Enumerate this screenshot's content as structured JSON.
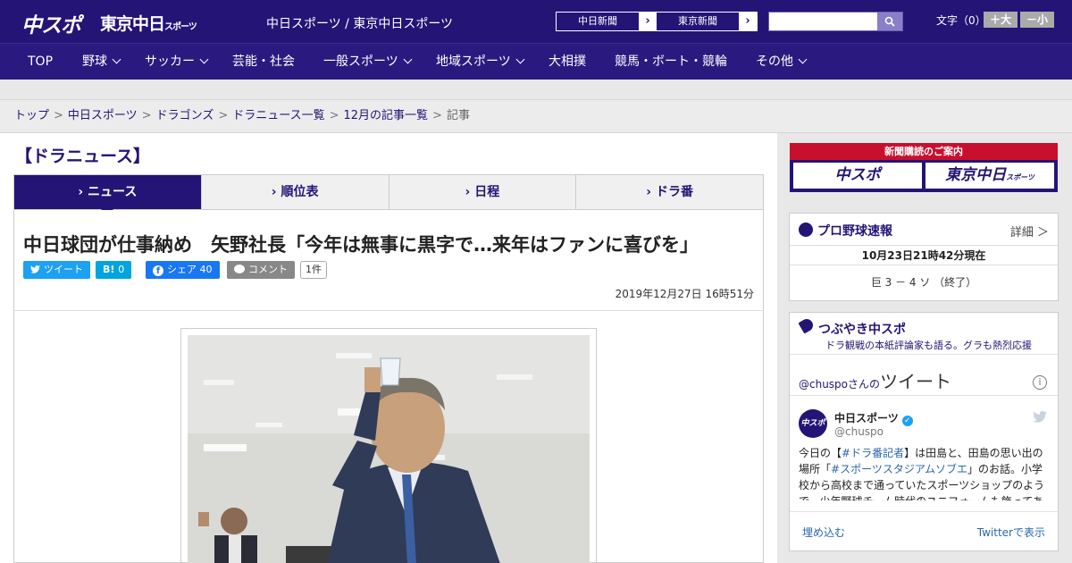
{
  "header": {
    "logo_chuspo": "中スポ",
    "logo_tokyo": "東京中日",
    "logo_tokyo_suffix": "スポーツ",
    "site_link": "中日スポーツ / 東京中日スポーツ",
    "newspaper_links": [
      "中日新聞",
      "東京新聞"
    ],
    "search_placeholder": "",
    "font_size_label": "文字（0）",
    "font_bigger": "＋大",
    "font_smaller": "－小"
  },
  "nav": {
    "items": [
      {
        "label": "TOP",
        "dropdown": false
      },
      {
        "label": "野球",
        "dropdown": true
      },
      {
        "label": "サッカー",
        "dropdown": true
      },
      {
        "label": "芸能・社会",
        "dropdown": false
      },
      {
        "label": "一般スポーツ",
        "dropdown": true
      },
      {
        "label": "地域スポーツ",
        "dropdown": true
      },
      {
        "label": "大相撲",
        "dropdown": false
      },
      {
        "label": "競馬・ボート・競輪",
        "dropdown": false
      },
      {
        "label": "その他",
        "dropdown": true
      }
    ]
  },
  "breadcrumb": {
    "items": [
      "トップ",
      "中日スポーツ",
      "ドラゴンズ",
      "ドラニュース一覧",
      "12月の記事一覧"
    ],
    "current": "記事",
    "separator": ">"
  },
  "section": {
    "title": "【ドラニュース】",
    "tabs": [
      {
        "label": "ニュース",
        "active": true
      },
      {
        "label": "順位表",
        "active": false
      },
      {
        "label": "日程",
        "active": false
      },
      {
        "label": "ドラ番",
        "active": false
      }
    ]
  },
  "article": {
    "headline": "中日球団が仕事納め　矢野社長「今年は無事に黒字で…来年はファンに喜びを」",
    "share": {
      "tweet": "ツイート",
      "hatena_icon": "B!",
      "hatena_count": "0",
      "facebook": "シェア",
      "facebook_count": "40",
      "comment": "コメント",
      "comment_count": "1件"
    },
    "date": "2019年12月27日 16時51分"
  },
  "sidebar": {
    "banner_title": "新聞購読のご案内",
    "banner_logos": [
      "中スポ",
      "東京中日"
    ],
    "banner_logo_suffix": "スポーツ",
    "baseball": {
      "title": "プロ野球速報",
      "more": "詳細 ＞",
      "time": "10月23日21時42分現在",
      "score": "巨  3  －  4  ソ   （終了）"
    },
    "tweets": {
      "title": "つぶやき中スポ",
      "subtitle": "ドラ観戦の本紙評論家も語る。グラも熱烈応援",
      "handle_prefix": "@chuspoさんの",
      "handle_suffix": "ツイート",
      "avatar_text": "中スポ",
      "account_name": "中日スポーツ",
      "account_handle": "@chuspo",
      "text_1": "今日の【",
      "link_1": "#ドラ番記者",
      "text_2": "】は田島と、田島の思い出の場所「",
      "link_2": "#スポーツスタジアムソブエ",
      "text_3": "」のお話。小学校から高校まで通っていたスポーツショップのようで、少年野球チーム時代のユニフォームも飾ってあ",
      "embed": "埋め込む",
      "view_on_twitter": "Twitterで表示"
    }
  },
  "colors": {
    "brand_navy": "#241476",
    "twitter": "#1da1f2",
    "hatena": "#00a4de",
    "facebook": "#1877f2",
    "comment": "#888888",
    "banner_red": "#c8102e"
  }
}
